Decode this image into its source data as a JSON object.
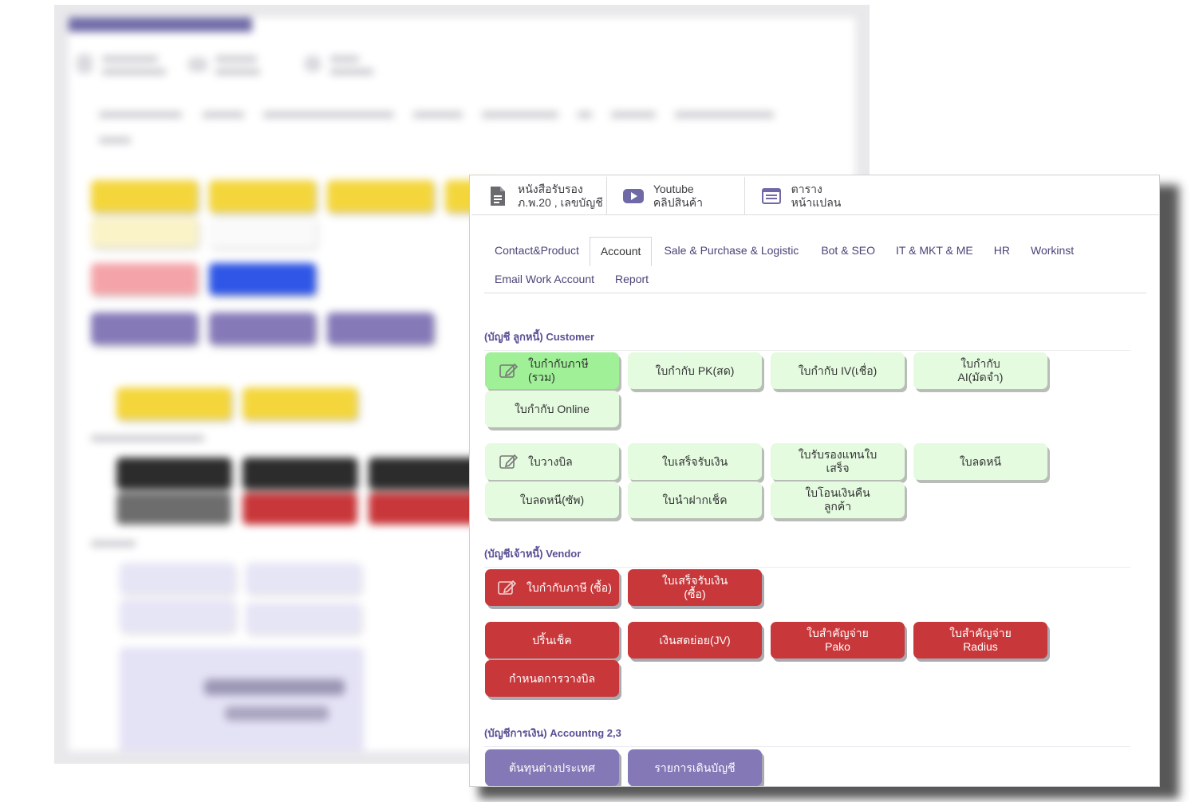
{
  "quick_links": [
    {
      "icon": "document-icon",
      "line1": "หนังสือรับรอง",
      "line2": "ภ.พ.20 , เลขบัญชี"
    },
    {
      "icon": "youtube-icon",
      "line1": "Youtube",
      "line2": "คลิปสินค้า"
    },
    {
      "icon": "table-list-icon",
      "line1": "ตาราง",
      "line2": "หน้าแปลน"
    }
  ],
  "tabs": {
    "row1": [
      "Contact&Product",
      "Account",
      "Sale & Purchase & Logistic",
      "Bot & SEO",
      "IT & MKT & ME",
      "HR",
      "Workinst"
    ],
    "row2": [
      "Email Work Account",
      "Report"
    ],
    "active": "Account"
  },
  "sections": {
    "customer": {
      "title": "(บัญชี ลูกหนี้) Customer",
      "buttons": [
        "ใบกำกับภาษี\n(รวม)",
        "ใบกำกับ PK(สด)",
        "ใบกำกับ IV(เชื่อ)",
        "ใบกำกับ\nAI(มัดจำ)",
        "ใบกำกับ Online",
        "ใบวางบิล",
        "ใบเสร็จรับเงิน",
        "ใบรับรองแทนใบ\nเสร็จ",
        "ใบลดหนี",
        "ใบลดหนี(ซัพ)",
        "ใบนำฝากเช็ค",
        "ใบโอนเงินคืน\nลูกค้า"
      ]
    },
    "vendor": {
      "title": "(บัญชีเจ้าหนี้) Vendor",
      "buttons": [
        "ใบกำกับภาษี (ซื้อ)",
        "ใบเสร็จรับเงิน\n(ซื้อ)",
        "ปริ้นเช็ค",
        "เงินสดย่อย(JV)",
        "ใบสำคัญจ่าย\nPako",
        "ใบสำคัญจ่าย\nRadius",
        "กำหนดการวางบิล"
      ]
    },
    "accounting": {
      "title": "(บัญชีการเงิน) Accountng 2,3",
      "buttons": [
        "ต้นทุนต่างประเทศ",
        "รายการเดินบัญชี"
      ]
    }
  },
  "icons": {
    "edit": "edit-icon"
  },
  "colors": {
    "green_button": "#e4fbe0",
    "green_highlight": "#9ff097",
    "red_button": "#c8373a",
    "purple_button": "#8478b6",
    "section_title": "#5b4f95"
  }
}
